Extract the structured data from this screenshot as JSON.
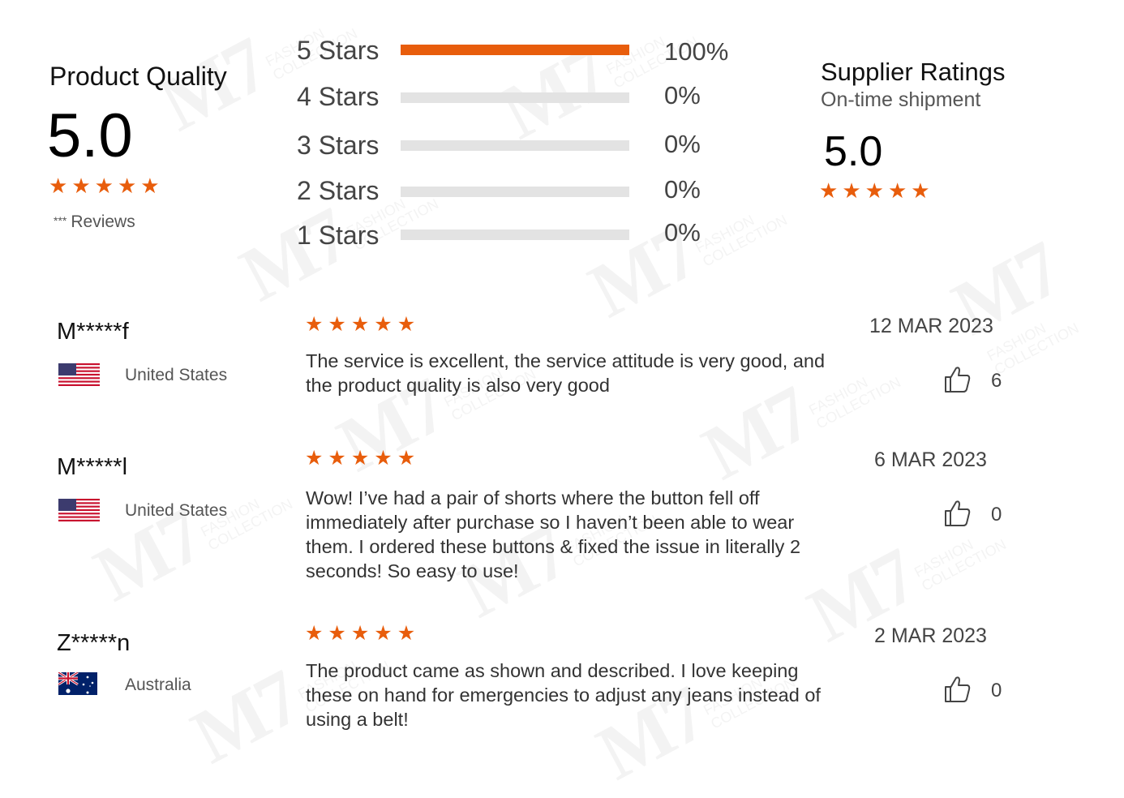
{
  "product_quality": {
    "title": "Product Quality",
    "score": "5.0",
    "rating_stars": 5,
    "reviews_mask": "***",
    "reviews_label": "Reviews"
  },
  "distribution": [
    {
      "label": "5 Stars",
      "percent": "100%",
      "fraction": 1.0
    },
    {
      "label": "4 Stars",
      "percent": "0%",
      "fraction": 0.0
    },
    {
      "label": "3 Stars",
      "percent": "0%",
      "fraction": 0.0
    },
    {
      "label": "2 Stars",
      "percent": "0%",
      "fraction": 0.0
    },
    {
      "label": "1 Stars",
      "percent": "0%",
      "fraction": 0.0
    }
  ],
  "supplier": {
    "title": "Supplier Ratings",
    "subtitle": "On-time shipment",
    "score": "5.0",
    "rating_stars": 5
  },
  "reviews": [
    {
      "name": "M*****f",
      "country": "United States",
      "flag": "us-flag-icon",
      "rating_stars": 5,
      "text": "The service is excellent, the service attitude is very good, and the product quality is also very good",
      "date": "12 MAR 2023",
      "likes": "6"
    },
    {
      "name": "M*****l",
      "country": "United States",
      "flag": "us-flag-icon",
      "rating_stars": 5,
      "text": "Wow! I’ve had a pair of shorts where the button fell off immediately after purchase so I haven’t been able to wear them. I ordered these buttons & fixed the issue in literally 2 seconds! So easy to use!",
      "date": "6 MAR 2023",
      "likes": "0"
    },
    {
      "name": "Z*****n",
      "country": "Australia",
      "flag": "au-flag-icon",
      "rating_stars": 5,
      "text": "The product came as shown and described. I love keeping these on hand for emergencies to adjust any jeans instead of using a belt!",
      "date": "2 MAR 2023",
      "likes": "0"
    }
  ],
  "watermark": {
    "logo": "M7",
    "line1": "FASHION",
    "line2": "COLLECTION"
  },
  "colors": {
    "accent": "#e85d0c",
    "track": "#e3e3e3"
  }
}
